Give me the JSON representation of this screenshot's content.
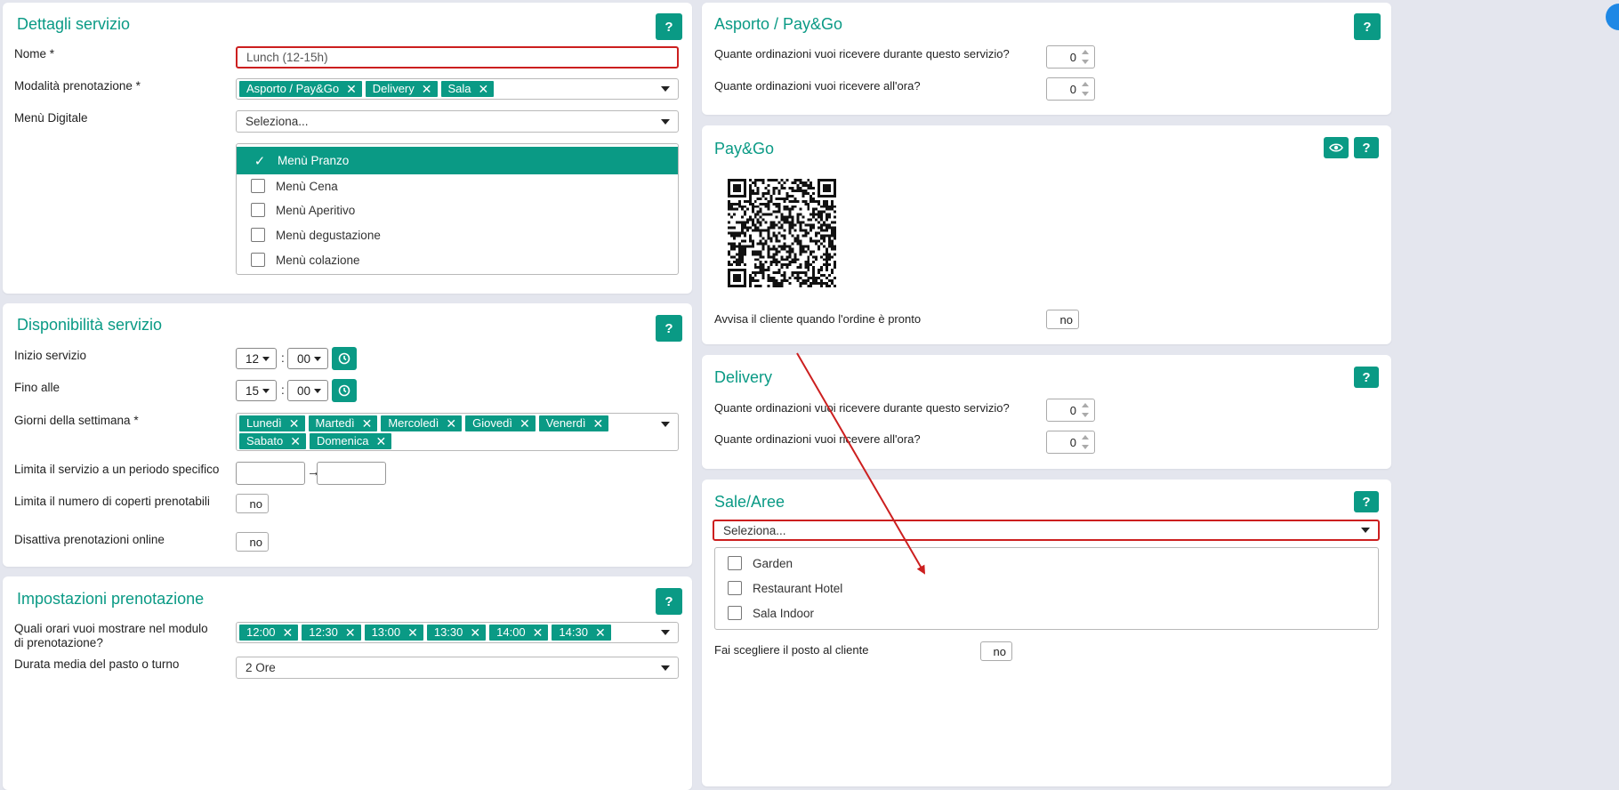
{
  "dettagli": {
    "title": "Dettagli servizio",
    "help": "?",
    "nome_label": "Nome *",
    "nome_value": "Lunch (12-15h)",
    "modalita_label": "Modalità prenotazione *",
    "modalita_tags": [
      "Asporto / Pay&Go",
      "Delivery",
      "Sala"
    ],
    "menu_label": "Menù Digitale",
    "menu_select": "Seleziona...",
    "menu_options": [
      {
        "label": "Menù Pranzo",
        "checked": true
      },
      {
        "label": "Menù Cena",
        "checked": false
      },
      {
        "label": "Menù Aperitivo",
        "checked": false
      },
      {
        "label": "Menù degustazione",
        "checked": false
      },
      {
        "label": "Menù colazione",
        "checked": false
      }
    ]
  },
  "disponibilita": {
    "title": "Disponibilità servizio",
    "help": "?",
    "inizio_label": "Inizio servizio",
    "inizio_h": "12",
    "inizio_m": "00",
    "fine_label": "Fino alle",
    "fine_h": "15",
    "fine_m": "00",
    "colon": ":",
    "giorni_label": "Giorni della settimana *",
    "giorni_tags": [
      "Lunedì",
      "Martedì",
      "Mercoledì",
      "Giovedì",
      "Venerdì",
      "Sabato",
      "Domenica"
    ],
    "periodo_label": "Limita il servizio a un periodo specifico",
    "arrow": "→",
    "coperti_label": "Limita il numero di coperti prenotabili",
    "coperti_toggle": "no",
    "online_label": "Disattiva prenotazioni online",
    "online_toggle": "no"
  },
  "impostazioni": {
    "title": "Impostazioni prenotazione",
    "help": "?",
    "orari_label": "Quali orari vuoi mostrare nel modulo di prenotazione?",
    "orari_tags": [
      "12:00",
      "12:30",
      "13:00",
      "13:30",
      "14:00",
      "14:30"
    ],
    "durata_label": "Durata media del pasto o turno",
    "durata_value": "2 Ore"
  },
  "asporto": {
    "title": "Asporto / Pay&Go",
    "help": "?",
    "q1": "Quante ordinazioni vuoi ricevere durante questo servizio?",
    "q1_value": "0",
    "q2": "Quante ordinazioni vuoi ricevere all'ora?",
    "q2_value": "0"
  },
  "paygo": {
    "title": "Pay&Go",
    "help": "?",
    "avvisa_label": "Avvisa il cliente quando l'ordine è pronto",
    "avvisa_toggle": "no"
  },
  "delivery": {
    "title": "Delivery",
    "help": "?",
    "q1": "Quante ordinazioni vuoi ricevere durante questo servizio?",
    "q1_value": "0",
    "q2": "Quante ordinazioni vuoi ricevere all'ora?",
    "q2_value": "0"
  },
  "sale": {
    "title": "Sale/Aree",
    "help": "?",
    "select": "Seleziona...",
    "options": [
      "Garden",
      "Restaurant Hotel",
      "Sala Indoor"
    ],
    "posto_label": "Fai scegliere il posto al cliente",
    "posto_toggle": "no"
  },
  "colors": {
    "accent": "#0a9a85",
    "highlight": "#cc1f1f",
    "background": "#e4e6ee"
  }
}
